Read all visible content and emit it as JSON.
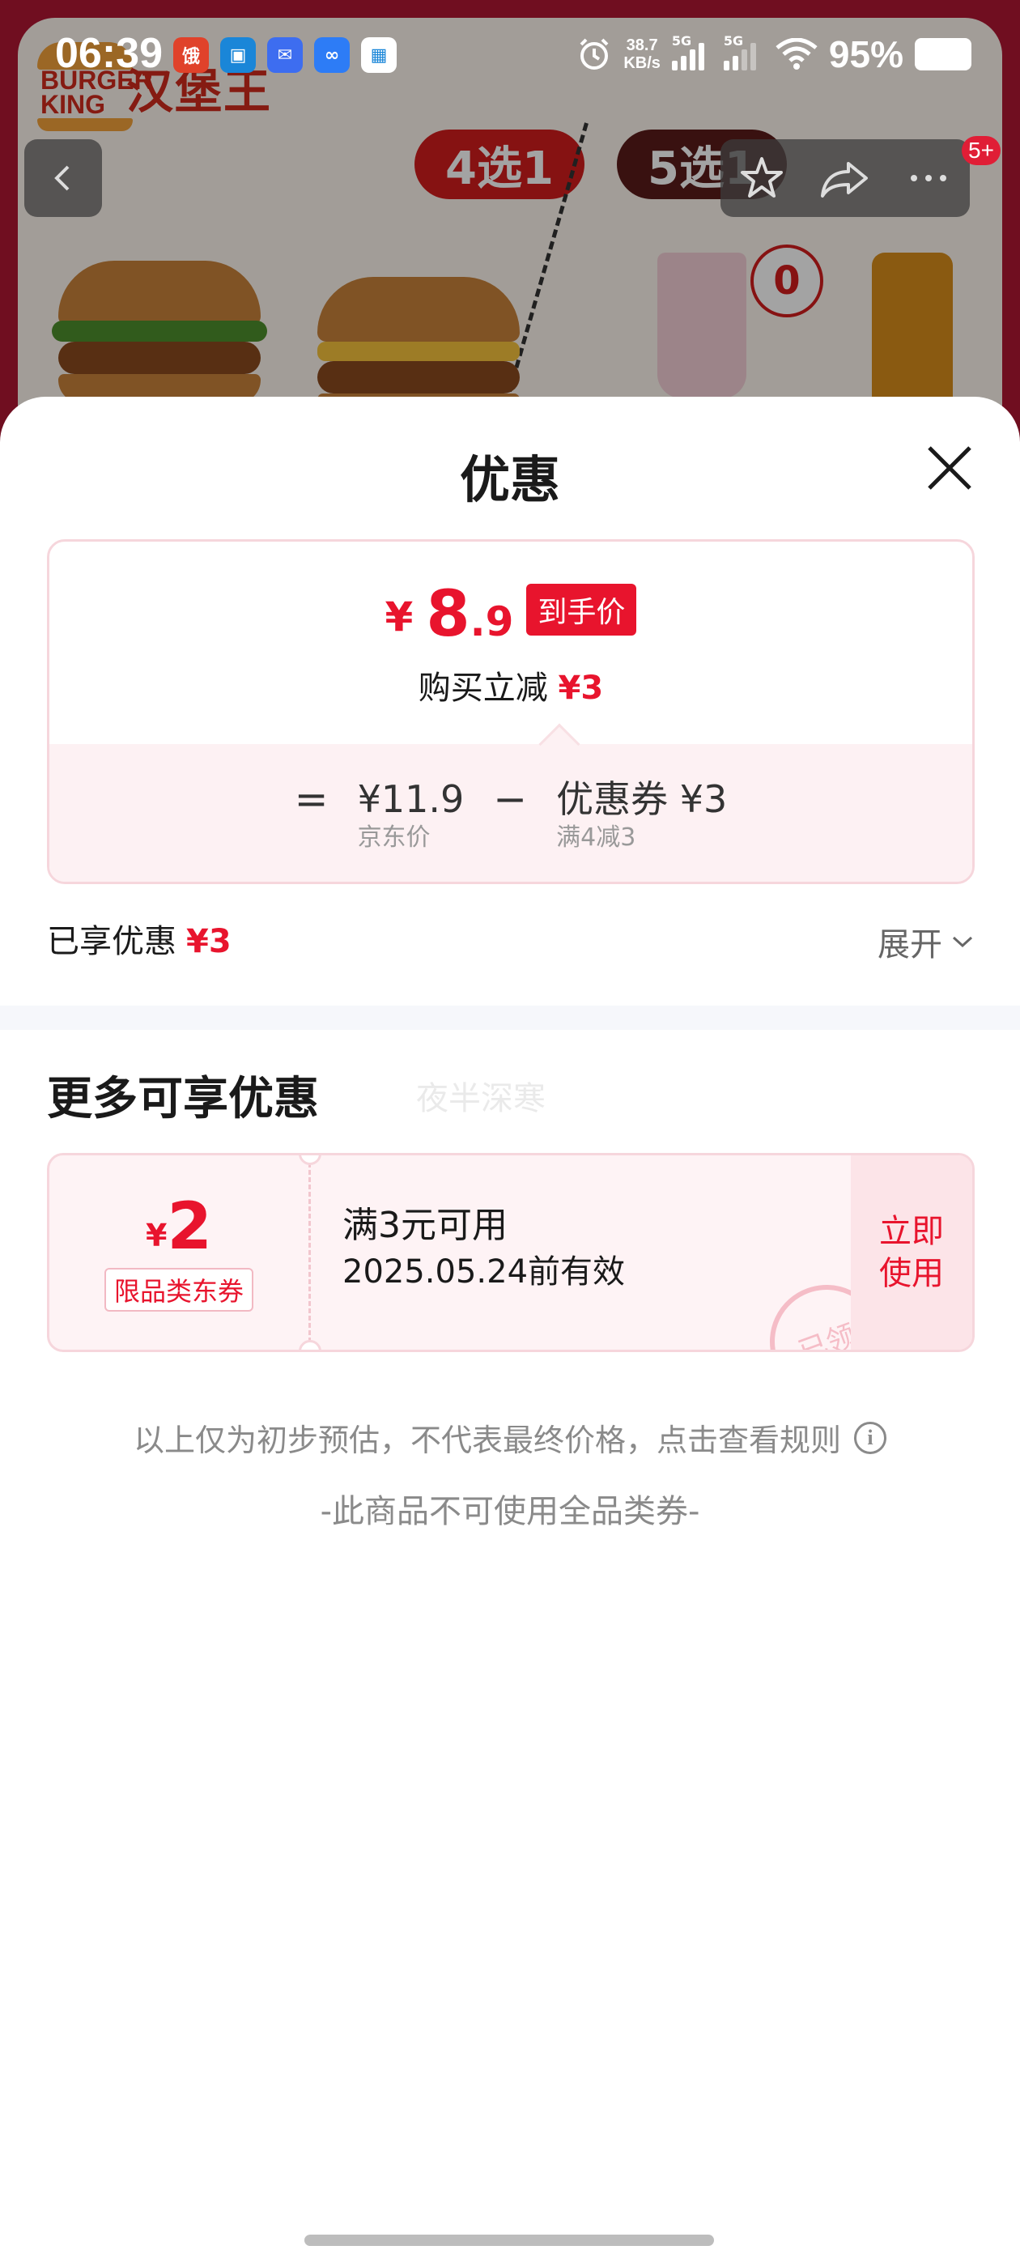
{
  "status_bar": {
    "time": "06:39",
    "net_speed_value": "38.7",
    "net_speed_unit": "KB/s",
    "signal_1": "5G",
    "signal_2": "5G",
    "battery": "95%"
  },
  "background": {
    "brand_text": "BURGER KING",
    "brand_cn": "汉堡王",
    "pick_a": "4选1",
    "pick_b": "5选1",
    "zero_badge": "0",
    "badge_count": "5+"
  },
  "sheet": {
    "title": "优惠",
    "price_card": {
      "currency": "¥",
      "price_int": "8",
      "price_dec": ".9",
      "price_tag": "到手价",
      "reduce_label": "购买立减",
      "reduce_value": "¥3",
      "equals": "=",
      "minus": "−",
      "base_value": "¥11.9",
      "base_label": "京东价",
      "coupon_value": "优惠券 ¥3",
      "coupon_label": "满4减3"
    },
    "enjoyed": {
      "label": "已享优惠",
      "value": "¥3",
      "expand": "展开"
    },
    "more": {
      "title": "更多可享优惠",
      "watermark": "夜半深寒"
    },
    "coupon": {
      "currency": "¥",
      "amount": "2",
      "type": "限品类东券",
      "condition": "满3元可用",
      "expiry": "2025.05.24前有效",
      "stamp": "已领",
      "action_line1": "立即",
      "action_line2": "使用"
    },
    "note": "以上仅为初步预估，不代表最终价格，点击查看规则",
    "note2": "-此商品不可使用全品类券-"
  },
  "colors": {
    "accent": "#e8142d",
    "card_border": "#f6d6dc",
    "card_bg": "#fef3f5"
  }
}
